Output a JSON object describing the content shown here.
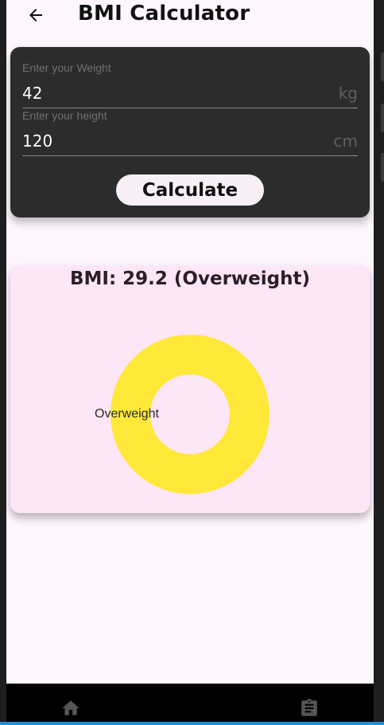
{
  "appbar": {
    "title": "BMI Calculator",
    "back_icon": "arrow-left-icon"
  },
  "inputs": {
    "weight": {
      "hint": "Enter your Weight",
      "value": "42",
      "unit": "kg"
    },
    "height": {
      "hint": "Enter your height",
      "value": "120",
      "unit": "cm"
    },
    "calculate_label": "Calculate"
  },
  "result": {
    "bmi_label": "BMI: 29.2 (Overweight)",
    "category": "Overweight",
    "bmi_value": 29.2,
    "colors": {
      "category_color": "#ffe838",
      "card_background": "#fde6f6"
    }
  },
  "bottom_nav": {
    "items": [
      {
        "icon": "home-icon"
      },
      {
        "icon": "clipboard-icon"
      }
    ]
  },
  "theme": {
    "card_dark": "#2c2c2c",
    "screen_bg": "#fdf6fd",
    "nav_bg": "#000000",
    "accent_line": "#1f8fd6"
  }
}
